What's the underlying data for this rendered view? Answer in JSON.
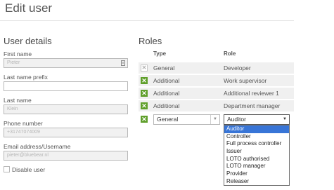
{
  "page": {
    "title": "Edit user"
  },
  "user_details": {
    "title": "User details",
    "first_name": {
      "label": "First name",
      "value": "Pieter"
    },
    "last_name_prefix": {
      "label": "Last name prefix",
      "value": ""
    },
    "last_name": {
      "label": "Last name",
      "value": "Klein"
    },
    "phone": {
      "label": "Phone number",
      "value": "+31747074009"
    },
    "email": {
      "label": "Email address/Username",
      "value": "pieter@bluebear.nl"
    },
    "disable_user": {
      "label": "Disable user",
      "checked": false
    }
  },
  "roles": {
    "title": "Roles",
    "headers": {
      "type": "Type",
      "role": "Role"
    },
    "rows": [
      {
        "type": "General",
        "role": "Developer",
        "removable": false
      },
      {
        "type": "Additional",
        "role": "Work supervisor",
        "removable": true
      },
      {
        "type": "Additional",
        "role": "Additional reviewer 1",
        "removable": true
      },
      {
        "type": "Additional",
        "role": "Department manager",
        "removable": true
      }
    ],
    "new_row": {
      "type_value": "General",
      "role_value": "Auditor"
    },
    "dropdown_options": [
      "Auditor",
      "Controller",
      "Full process controller",
      "Issuer",
      "LOTO authorised",
      "LOTO manager",
      "Provider",
      "Releaser"
    ],
    "dropdown_selected": "Auditor"
  },
  "icons": {
    "remove": "remove-x-icon",
    "dropdown": "chevron-down-icon",
    "field_lookup": "contact-card-icon"
  },
  "colors": {
    "remove_button": "#5f9f2a",
    "row_background": "#f0f0f0",
    "option_highlight": "#3875d7"
  }
}
